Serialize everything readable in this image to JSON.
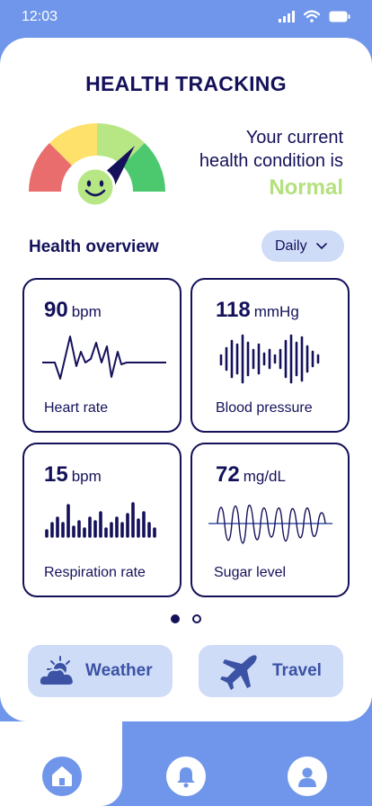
{
  "status_bar": {
    "time": "12:03"
  },
  "header": {
    "title": "HEALTH TRACKING"
  },
  "condition": {
    "line1": "Your current",
    "line2": "health condition is",
    "status": "Normal",
    "status_color": "#b4e17e"
  },
  "overview": {
    "title": "Health overview",
    "period": "Daily"
  },
  "metrics": [
    {
      "value": "90",
      "unit": "bpm",
      "label": "Heart rate",
      "icon": "heartbeat-graph"
    },
    {
      "value": "118",
      "unit": "mmHg",
      "label": "Blood pressure",
      "icon": "pressure-wave-graph"
    },
    {
      "value": "15",
      "unit": "bpm",
      "label": "Respiration rate",
      "icon": "respiration-bars-graph"
    },
    {
      "value": "72",
      "unit": "mg/dL",
      "label": "Sugar level",
      "icon": "sugar-wave-graph"
    }
  ],
  "pager": {
    "pages": 2,
    "active": 0
  },
  "actions": [
    {
      "label": "Weather",
      "icon": "weather-icon"
    },
    {
      "label": "Travel",
      "icon": "airplane-icon"
    }
  ],
  "bottom_nav": [
    {
      "name": "home",
      "icon": "home-icon",
      "active": true
    },
    {
      "name": "notifications",
      "icon": "bell-icon",
      "active": false
    },
    {
      "name": "profile",
      "icon": "user-icon",
      "active": false
    }
  ],
  "colors": {
    "primary": "#14115a",
    "accent": "#6f96ea",
    "light_accent": "#cfdcf8",
    "normal": "#b4e17e"
  }
}
